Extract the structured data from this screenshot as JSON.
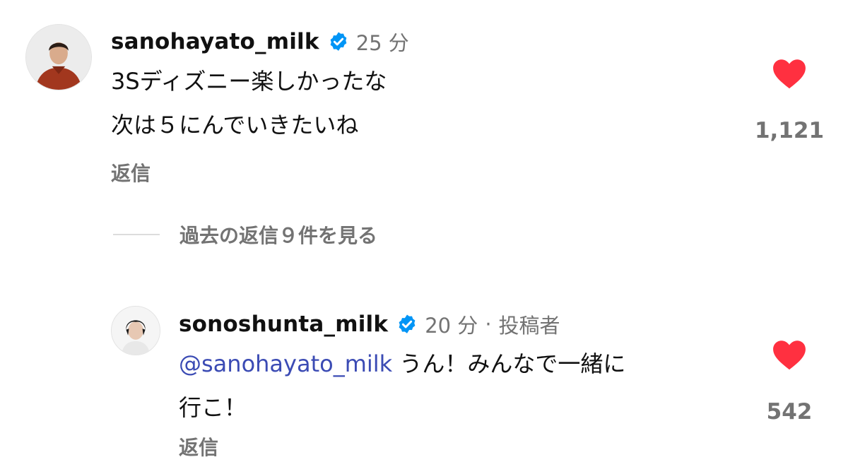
{
  "comments": [
    {
      "username": "sanohayato_milk",
      "time": "25 分",
      "lines": [
        "3Sディズニー楽しかったな",
        "次は５にんでいきたいね"
      ],
      "reply_label": "返信",
      "likes": "1,121"
    },
    {
      "username": "sonoshunta_milk",
      "time": "20 分",
      "author_label": "投稿者",
      "separator": "·",
      "mention": "@sanohayato_milk",
      "text_line1": " うん！みんなで一緒に",
      "text_line2": "行こ！",
      "reply_label": "返信",
      "likes": "542"
    }
  ],
  "view_replies": {
    "label": "過去の返信９件を見る"
  },
  "colors": {
    "verified_badge": "#0095f6",
    "heart": "#ff3040",
    "mention": "#3b4bb4",
    "secondary_text": "#737373"
  },
  "icons": {
    "verified": "verified-badge-icon",
    "like": "heart-icon"
  }
}
